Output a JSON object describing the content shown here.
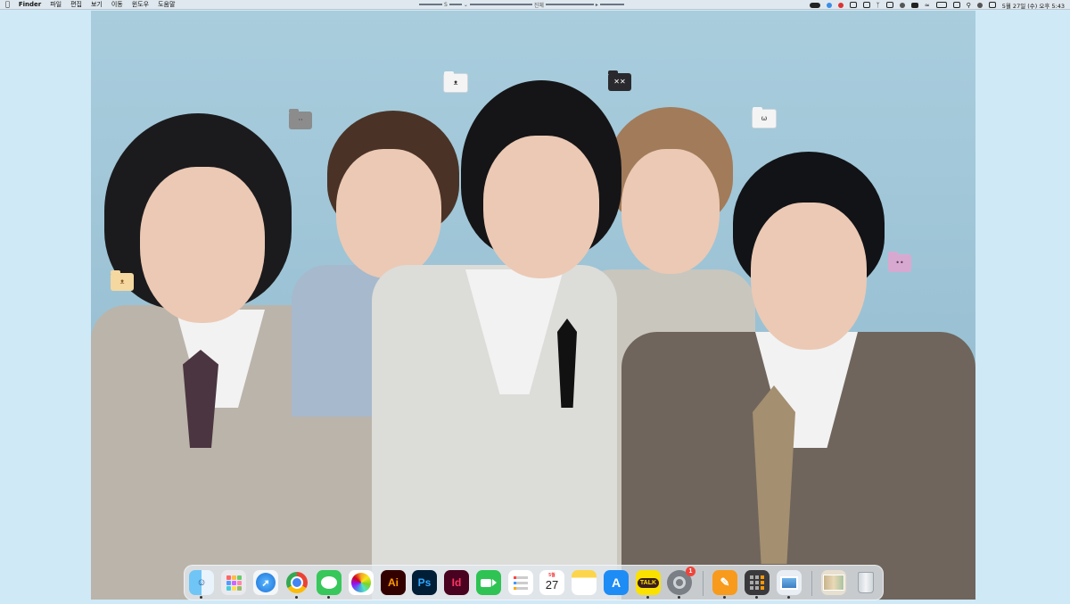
{
  "menubar": {
    "app_name": "Finder",
    "menus": [
      "파일",
      "편집",
      "보기",
      "이동",
      "윈도우",
      "도움말"
    ],
    "center_left": "S",
    "center_label": "진체",
    "datetime": "5월 27일 (수) 오후 5:43"
  },
  "dock": {
    "apps": [
      {
        "name": "Finder",
        "icon": "finder-icon"
      },
      {
        "name": "Launchpad",
        "icon": "launchpad-icon"
      },
      {
        "name": "Safari",
        "icon": "safari-icon"
      },
      {
        "name": "Chrome",
        "icon": "chrome-icon"
      },
      {
        "name": "Messages",
        "icon": "messages-icon"
      },
      {
        "name": "Photos",
        "icon": "photos-icon"
      },
      {
        "name": "Illustrator",
        "label": "Ai"
      },
      {
        "name": "Photoshop",
        "label": "Ps"
      },
      {
        "name": "InDesign",
        "label": "Id"
      },
      {
        "name": "FaceTime",
        "icon": "facetime-icon"
      },
      {
        "name": "Reminders",
        "icon": "reminders-icon"
      },
      {
        "name": "Calendar",
        "month": "5월",
        "day": "27"
      },
      {
        "name": "Notes",
        "icon": "notes-icon"
      },
      {
        "name": "App Store",
        "icon": "appstore-icon"
      },
      {
        "name": "KakaoTalk",
        "label": "TALK"
      },
      {
        "name": "System Preferences",
        "badge": "1"
      },
      {
        "name": "Pages",
        "icon": "pages-icon"
      },
      {
        "name": "Calculator",
        "icon": "calculator-icon"
      },
      {
        "name": "Preview",
        "icon": "preview-icon"
      },
      {
        "name": "Folder Stack",
        "icon": "stack-icon"
      },
      {
        "name": "Trash",
        "icon": "trash-icon"
      }
    ]
  },
  "colors": {
    "desktop_bg": "#cfe9f7",
    "accent_red": "#f0443a"
  }
}
